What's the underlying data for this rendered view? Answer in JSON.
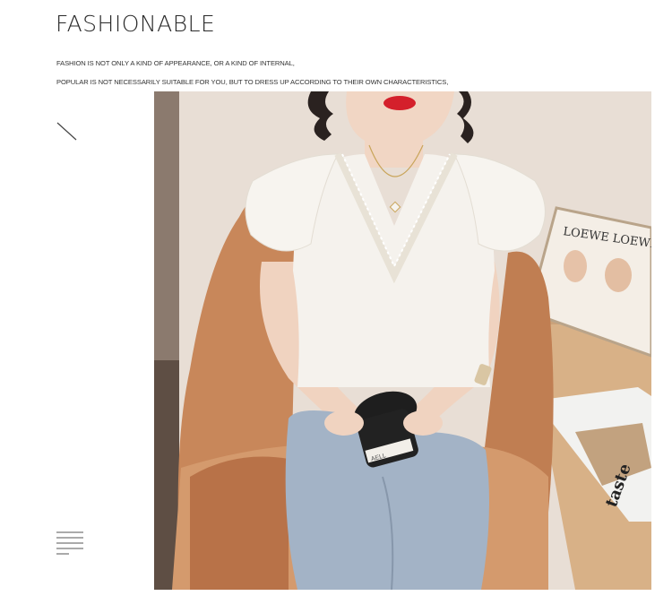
{
  "header": {
    "title": "FASHIONABLE",
    "line1": "FASHION IS NOT ONLY A KIND OF APPEARANCE, OR A KIND OF INTERNAL,",
    "line2": "POPULAR IS NOT NECESSARILY SUITABLE FOR YOU, BUT TO DRESS UP ACCORDING TO THEIR OWN CHARACTERISTICS,"
  },
  "photo": {
    "poster_text": "LOEWE LOEWE",
    "magazine_text": "taste",
    "cup_text": "AELL"
  },
  "colors": {
    "wall": "#e9e0d8",
    "chair": "#c98a5f",
    "top": "#f4f1ec",
    "jeans": "#9fb0c4",
    "table": "#d9b48d"
  }
}
